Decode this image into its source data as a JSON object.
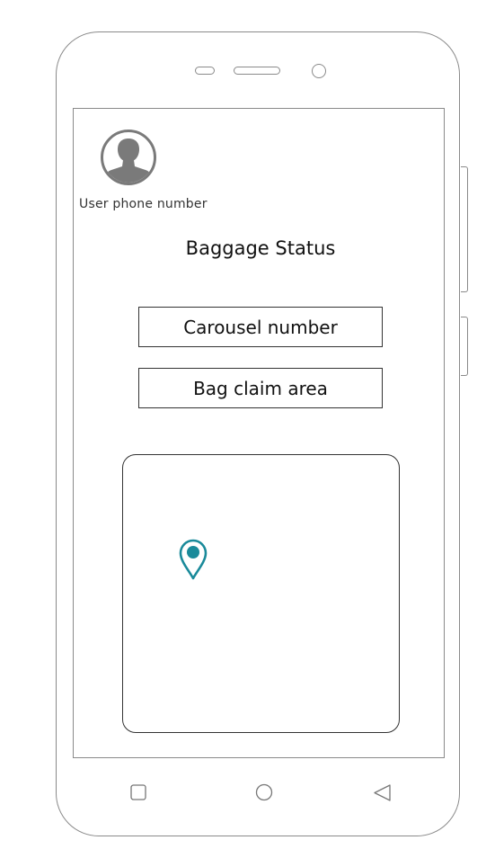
{
  "user": {
    "phone_label": "User phone number"
  },
  "page": {
    "title": "Baggage Status"
  },
  "fields": {
    "carousel": "Carousel number",
    "claim_area": "Bag claim area"
  },
  "map": {
    "marker_icon": "location-pin-icon",
    "marker_color": "#1a8a9a"
  },
  "icons": {
    "avatar": "user-avatar-icon",
    "nav_recent": "square-icon",
    "nav_home": "circle-icon",
    "nav_back": "triangle-back-icon"
  },
  "colors": {
    "outline": "#8a8a8a",
    "accent": "#1a8a9a"
  }
}
